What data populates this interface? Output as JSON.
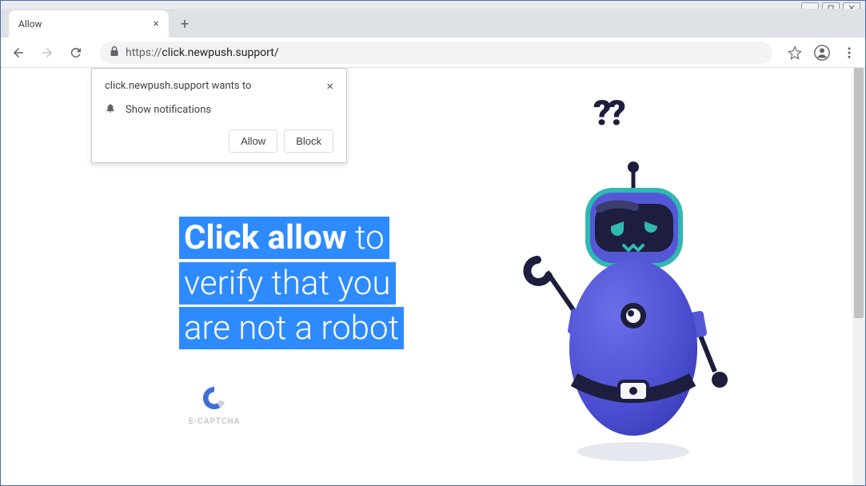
{
  "window": {
    "tab_title": "Allow"
  },
  "toolbar": {
    "url_scheme": "https://",
    "url_host_path": "click.newpush.support/"
  },
  "permission_dialog": {
    "title": "click.newpush.support wants to",
    "item": "Show notifications",
    "allow_label": "Allow",
    "block_label": "Block"
  },
  "page": {
    "hero_bold": "Click allow",
    "hero_rest_1": " to",
    "hero_line2": "verify that you",
    "hero_line3": "are not a robot",
    "captcha_label": "E-CAPTCHA",
    "question_marks": "??"
  }
}
